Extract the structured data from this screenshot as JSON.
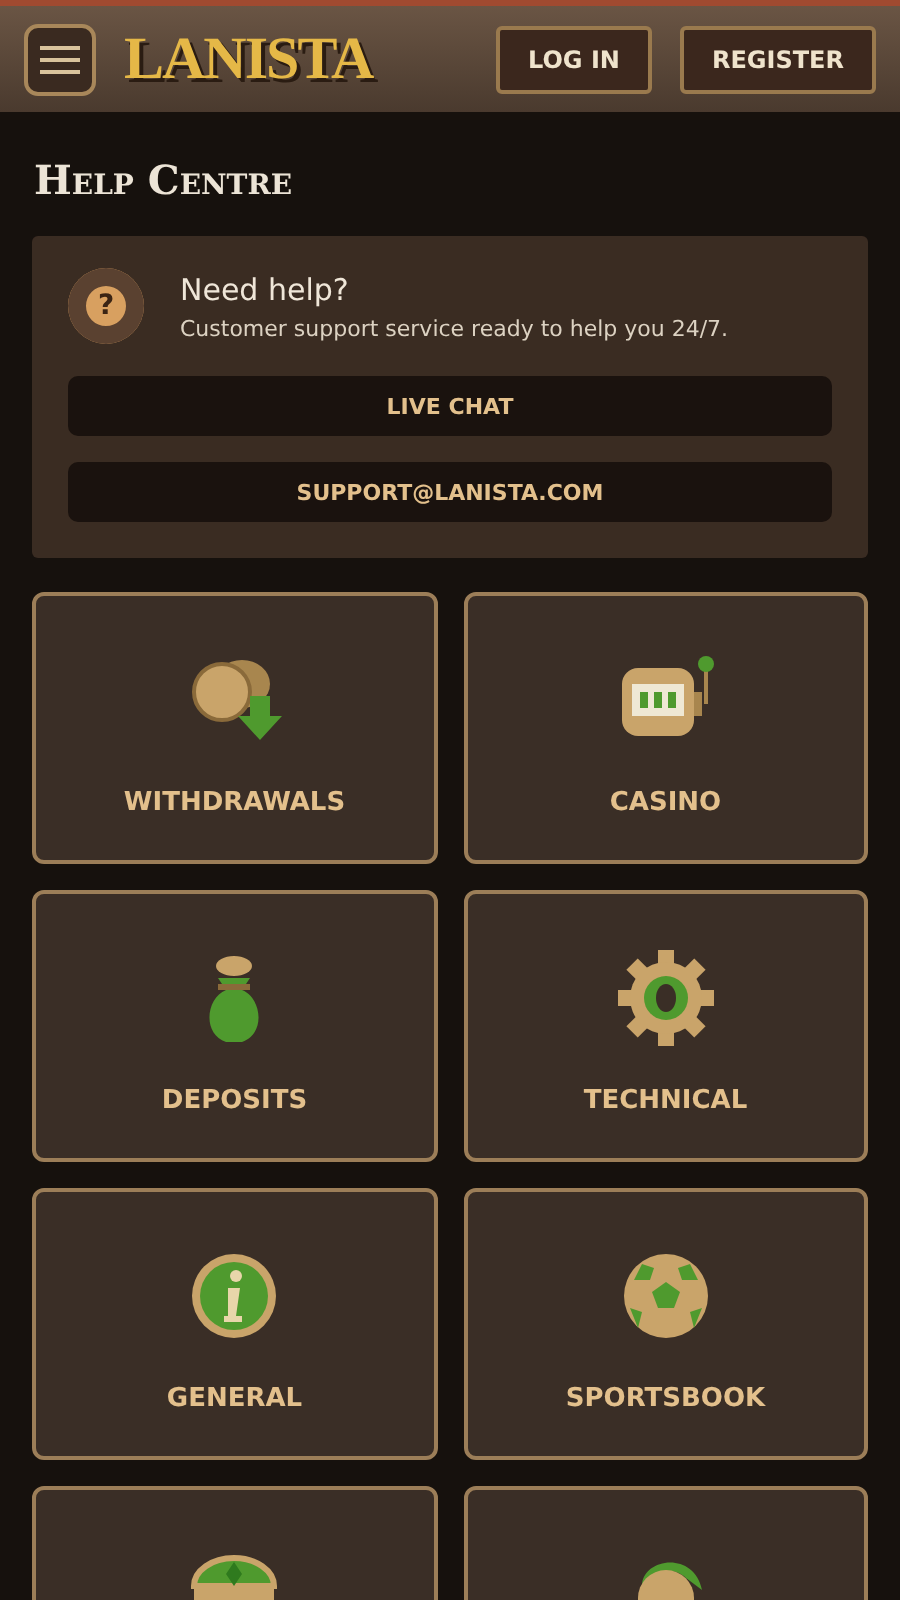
{
  "header": {
    "logo": "LANISTA",
    "buttons": [
      "LOG IN",
      "REGISTER"
    ]
  },
  "title": "Help Centre",
  "support": {
    "heading": "Need help?",
    "text": "Customer support service ready to help you 24/7.",
    "icon": "?",
    "buttons": [
      "LIVE CHAT",
      "SUPPORT@LANISTA.COM"
    ]
  },
  "categories": [
    {
      "kind": "withdraw",
      "label": "WITHDRAWALS"
    },
    {
      "kind": "slot",
      "label": "CASINO"
    },
    {
      "kind": "bag",
      "label": "DEPOSITS"
    },
    {
      "kind": "gear",
      "label": "TECHNICAL"
    },
    {
      "kind": "info",
      "label": "GENERAL"
    },
    {
      "kind": "ball",
      "label": "SPORTSBOOK"
    },
    {
      "kind": "chest"
    },
    {
      "kind": "helmet"
    }
  ]
}
